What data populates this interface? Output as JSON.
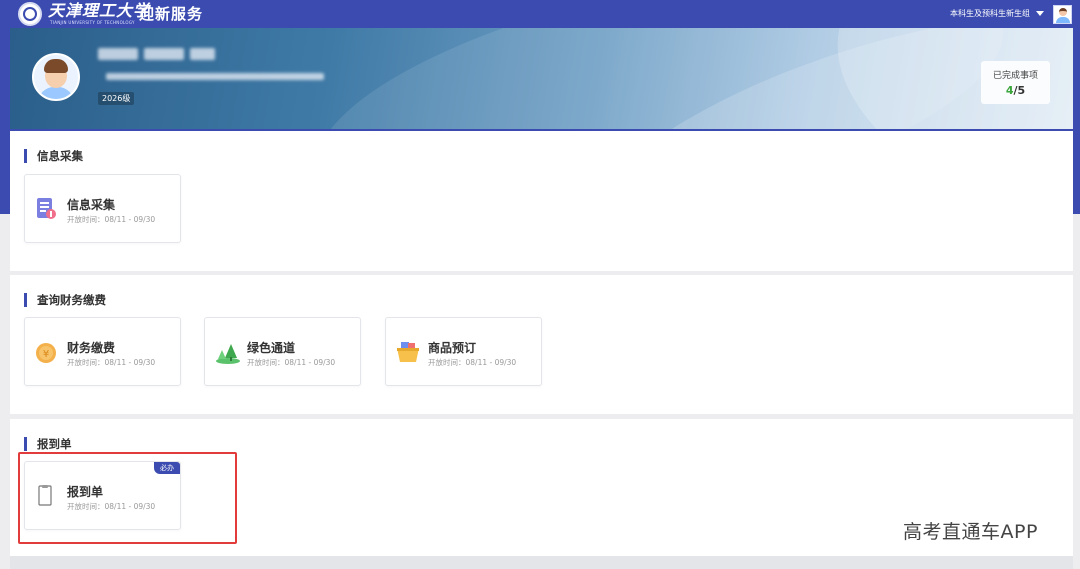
{
  "header": {
    "university_name": "天津理工大学",
    "university_sub": "TIANJIN UNIVERSITY OF TECHNOLOGY",
    "app_title": "迎新服务",
    "group_selector": "本科生及预科生新生组"
  },
  "profile": {
    "grade": "2026级",
    "completed_label": "已完成事项",
    "completed_done": "4",
    "completed_total": "/5"
  },
  "sections": {
    "info": {
      "title": "信息采集",
      "cards": [
        {
          "name": "信息采集",
          "time": "开放时间：08/11 - 09/30"
        }
      ]
    },
    "finance": {
      "title": "查询财务缴费",
      "cards": [
        {
          "name": "财务缴费",
          "time": "开放时间：08/11 - 09/30"
        },
        {
          "name": "绿色通道",
          "time": "开放时间：08/11 - 09/30"
        },
        {
          "name": "商品预订",
          "time": "开放时间：08/11 - 09/30"
        }
      ]
    },
    "checkin": {
      "title": "报到单",
      "cards": [
        {
          "name": "报到单",
          "time": "开放时间：08/11 - 09/30",
          "tag": "必办"
        }
      ]
    }
  },
  "watermark": "高考直通车APP",
  "colors": {
    "brand": "#3b4bb0",
    "highlight": "#e23b3b",
    "done": "#3aa53a"
  }
}
